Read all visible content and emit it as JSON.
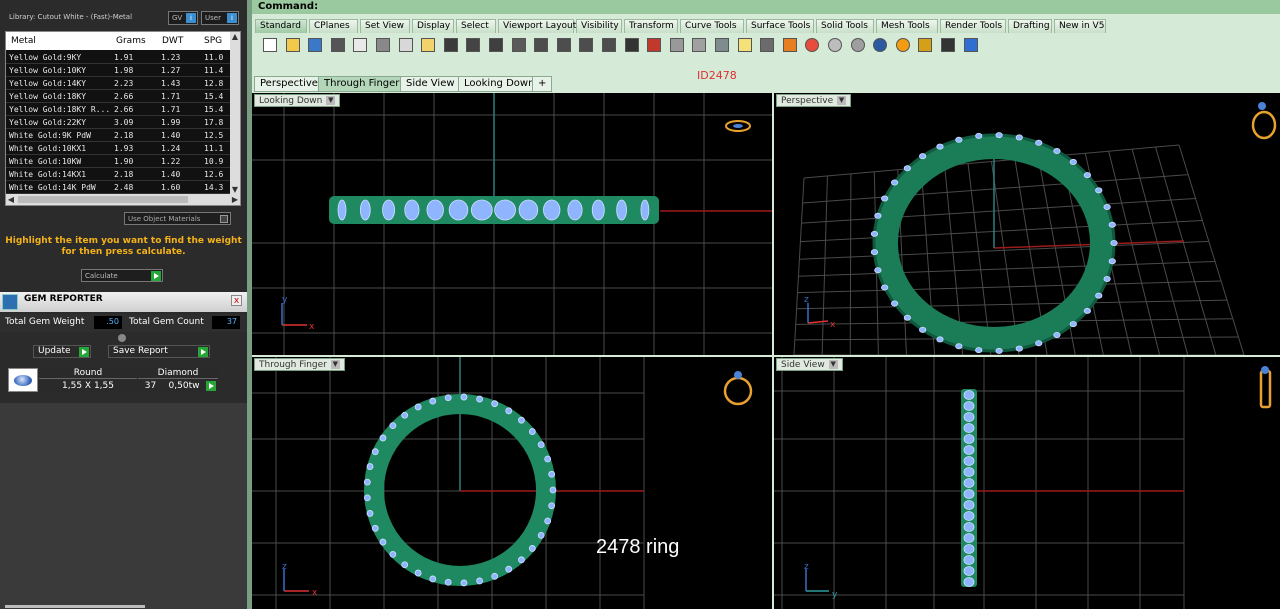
{
  "library": {
    "label": "Library: Cutout White - (Fast)-Metal",
    "gv_label": "GV",
    "user_label": "User",
    "info_icon": "info-icon"
  },
  "metal_table": {
    "headers": [
      "Metal",
      "Grams",
      "DWT",
      "SPG"
    ],
    "rows": [
      [
        "Yellow Gold:9KY",
        "1.91",
        "1.23",
        "11.0"
      ],
      [
        "Yellow Gold:10KY",
        "1.98",
        "1.27",
        "11.4"
      ],
      [
        "Yellow Gold:14KY",
        "2.23",
        "1.43",
        "12.8"
      ],
      [
        "Yellow Gold:18KY",
        "2.66",
        "1.71",
        "15.4"
      ],
      [
        "Yellow Gold:18KY R...",
        "2.66",
        "1.71",
        "15.4"
      ],
      [
        "Yellow Gold:22KY",
        "3.09",
        "1.99",
        "17.8"
      ],
      [
        "White Gold:9K PdW",
        "2.18",
        "1.40",
        "12.5"
      ],
      [
        "White Gold:10KX1",
        "1.93",
        "1.24",
        "11.1"
      ],
      [
        "White Gold:10KW",
        "1.90",
        "1.22",
        "10.9"
      ],
      [
        "White Gold:14KX1",
        "2.18",
        "1.40",
        "12.6"
      ],
      [
        "White Gold:14K PdW",
        "2.48",
        "1.60",
        "14.3"
      ]
    ]
  },
  "use_object_materials": "Use Object Materials",
  "hint": {
    "line1": "Highlight the item you want to find the weight",
    "line2": "for then press calculate."
  },
  "calculate_label": "Calculate",
  "gem_reporter": {
    "title": "GEM REPORTER",
    "close": "x",
    "total_weight_label": "Total Gem Weight",
    "total_weight_value": ".50",
    "total_count_label": "Total Gem Count",
    "total_count_value": "37",
    "update_label": "Update",
    "save_report_label": "Save Report",
    "gem": {
      "shape": "Round",
      "material": "Diamond",
      "size": "1,55 X 1,55",
      "count": "37",
      "weight": "0,50tw"
    }
  },
  "rhino": {
    "command_label": "Command:",
    "tabs": [
      "Standard",
      "CPlanes",
      "Set View",
      "Display",
      "Select",
      "Viewport Layout",
      "Visibility",
      "Transform",
      "Curve Tools",
      "Surface Tools",
      "Solid Tools",
      "Mesh Tools",
      "Render Tools",
      "Drafting",
      "New in V5"
    ],
    "active_tab": "Standard",
    "toolbar_icons": [
      "new-icon",
      "open-icon",
      "save-icon",
      "print-icon",
      "import-icon",
      "cut-icon",
      "copy-icon",
      "paste-icon",
      "undo-icon",
      "pan-icon",
      "rotate-view-icon",
      "zoom-icon",
      "zoom-window-icon",
      "zoom-extents-icon",
      "zoom-selected-icon",
      "undo-view-icon",
      "four-viewports-icon",
      "cplane-icon",
      "grid-snap-icon",
      "object-snap-icon",
      "points-icon",
      "light-icon",
      "lock-icon",
      "layer-icon",
      "color-icon",
      "shaded-icon",
      "rendered-icon",
      "render-icon",
      "properties-icon",
      "options-icon",
      "select-icon",
      "help-icon"
    ],
    "viewport_tabs": [
      "Perspective",
      "Through Finger",
      "Side View",
      "Looking Down"
    ],
    "active_viewport_tab": "Through Finger",
    "add_tab": "+",
    "id_label": "ID2478",
    "viewports": {
      "top_left": "Looking Down",
      "top_right": "Perspective",
      "bottom_left": "Through Finger",
      "bottom_right": "Side View"
    },
    "axis": {
      "x": "x",
      "y": "y",
      "z": "z"
    },
    "overlay_caption": "2478 ring"
  },
  "colors": {
    "ring_green": "#1f8a62",
    "gem_blue": "#8fb5ff",
    "grid": "#555555",
    "accent_red": "#d32020",
    "accent_orange": "#f3b21a"
  }
}
